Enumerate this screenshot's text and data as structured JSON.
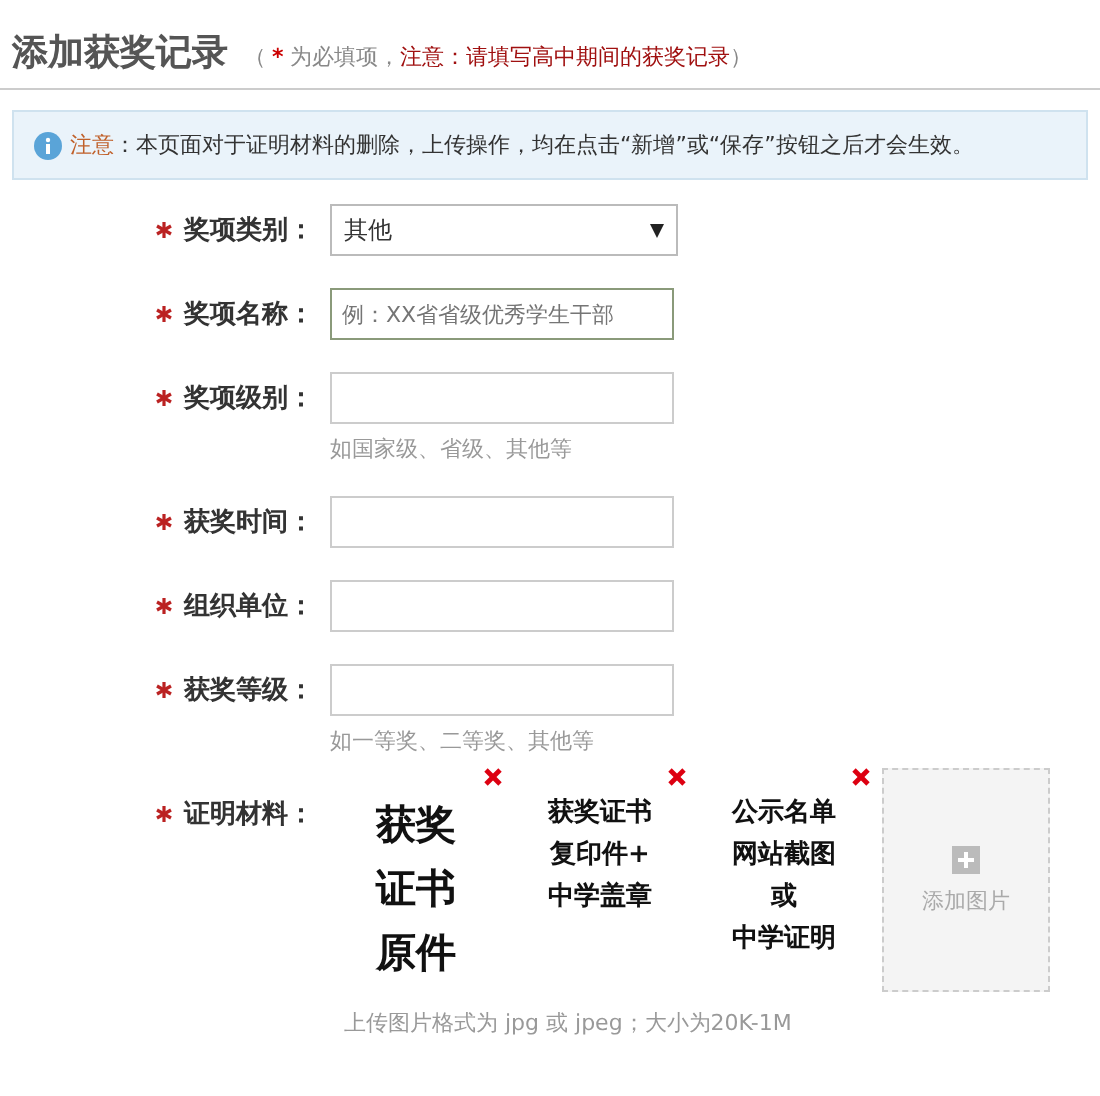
{
  "header": {
    "title": "添加获奖记录",
    "note_open": "（",
    "required_mark": "*",
    "required_text": "为必填项，",
    "warning": "注意：请填写高中期间的获奖记录",
    "note_close": "）"
  },
  "notice": {
    "label": "注意",
    "text": "：本页面对于证明材料的删除，上传操作，均在点击“新增”或“保存”按钮之后才会生效。"
  },
  "fields": [
    {
      "kind": "select",
      "required": true,
      "label": "奖项类别：",
      "value": "其他"
    },
    {
      "kind": "text",
      "required": true,
      "label": "奖项名称：",
      "placeholder": "例：XX省省级优秀学生干部",
      "focused": true
    },
    {
      "kind": "text",
      "required": true,
      "label": "奖项级别：",
      "hint": "如国家级、省级、其他等"
    },
    {
      "kind": "text",
      "required": true,
      "label": "获奖时间："
    },
    {
      "kind": "text",
      "required": true,
      "label": "组织单位："
    },
    {
      "kind": "text",
      "required": true,
      "label": "获奖等级：",
      "hint": "如一等奖、二等奖、其他等"
    }
  ],
  "attachments": {
    "required": true,
    "label": "证明材料：",
    "images": [
      {
        "lines": [
          "获奖",
          "证书",
          "原件"
        ],
        "kind": "large"
      },
      {
        "lines": [
          "获奖证书",
          "复印件+",
          "中学盖章"
        ],
        "kind": "small"
      },
      {
        "lines": [
          "公示名单",
          "网站截图",
          "或",
          "中学证明"
        ],
        "kind": "small"
      }
    ],
    "add_label": "添加图片",
    "hint": "上传图片格式为 jpg 或 jpeg；大小为20K-1M"
  }
}
